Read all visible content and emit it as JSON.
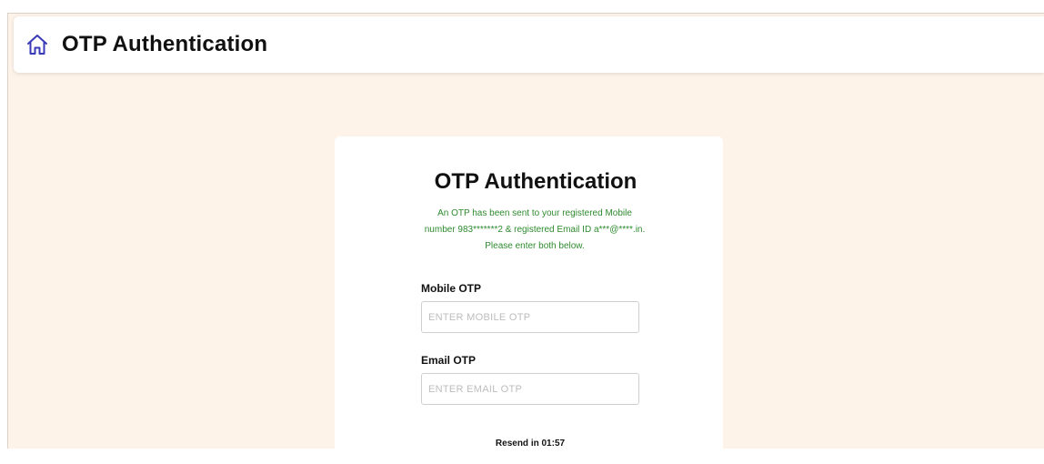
{
  "header": {
    "title": "OTP Authentication",
    "icon": "home-icon"
  },
  "card": {
    "title": "OTP Authentication",
    "info_text": "An OTP has been sent to your registered Mobile number 983*******2 & registered Email ID a***@****.in. Please enter both below.",
    "mobile_label": "Mobile OTP",
    "mobile_placeholder": "ENTER MOBILE OTP",
    "mobile_value": "",
    "email_label": "Email OTP",
    "email_placeholder": "ENTER EMAIL OTP",
    "email_value": "",
    "resend_text": "Resend in 01:57"
  },
  "colors": {
    "page_background": "#fdf3e9",
    "info_text": "#2e8a2e",
    "home_icon": "#3a3ab8"
  }
}
